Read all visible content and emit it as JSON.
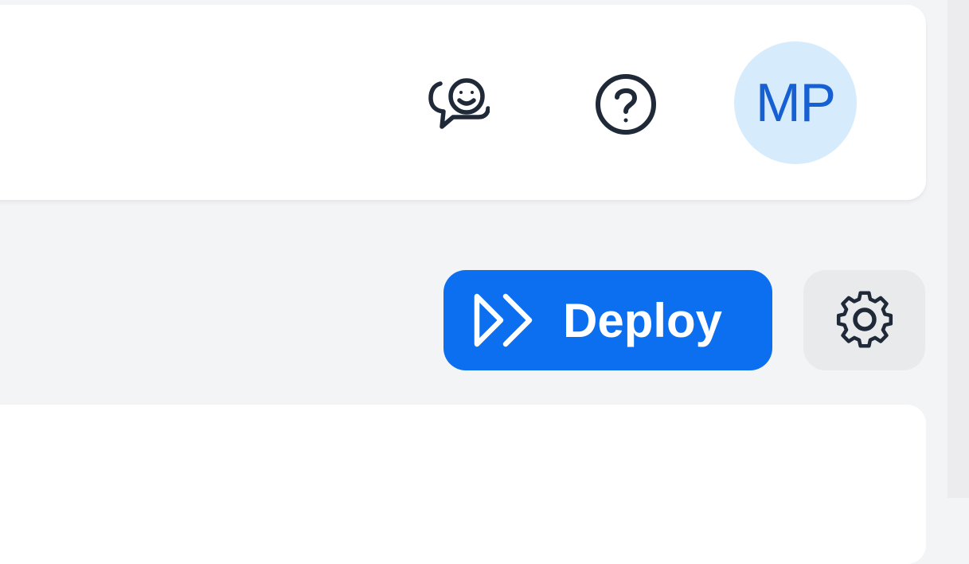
{
  "header": {
    "feedback_icon": "feedback-chat-smile-icon",
    "help_icon": "help-circle-icon",
    "avatar_initials": "MP"
  },
  "toolbar": {
    "deploy_label": "Deploy",
    "deploy_icon": "double-chevron-play-icon",
    "settings_icon": "gear-icon"
  },
  "colors": {
    "page_background": "#f3f4f6",
    "panel_background": "#ffffff",
    "primary": "#0b6ff0",
    "avatar_background": "#d6ebfb",
    "avatar_text": "#1760d4",
    "icon_stroke": "#1f2937",
    "secondary_button": "#e9eaec"
  }
}
